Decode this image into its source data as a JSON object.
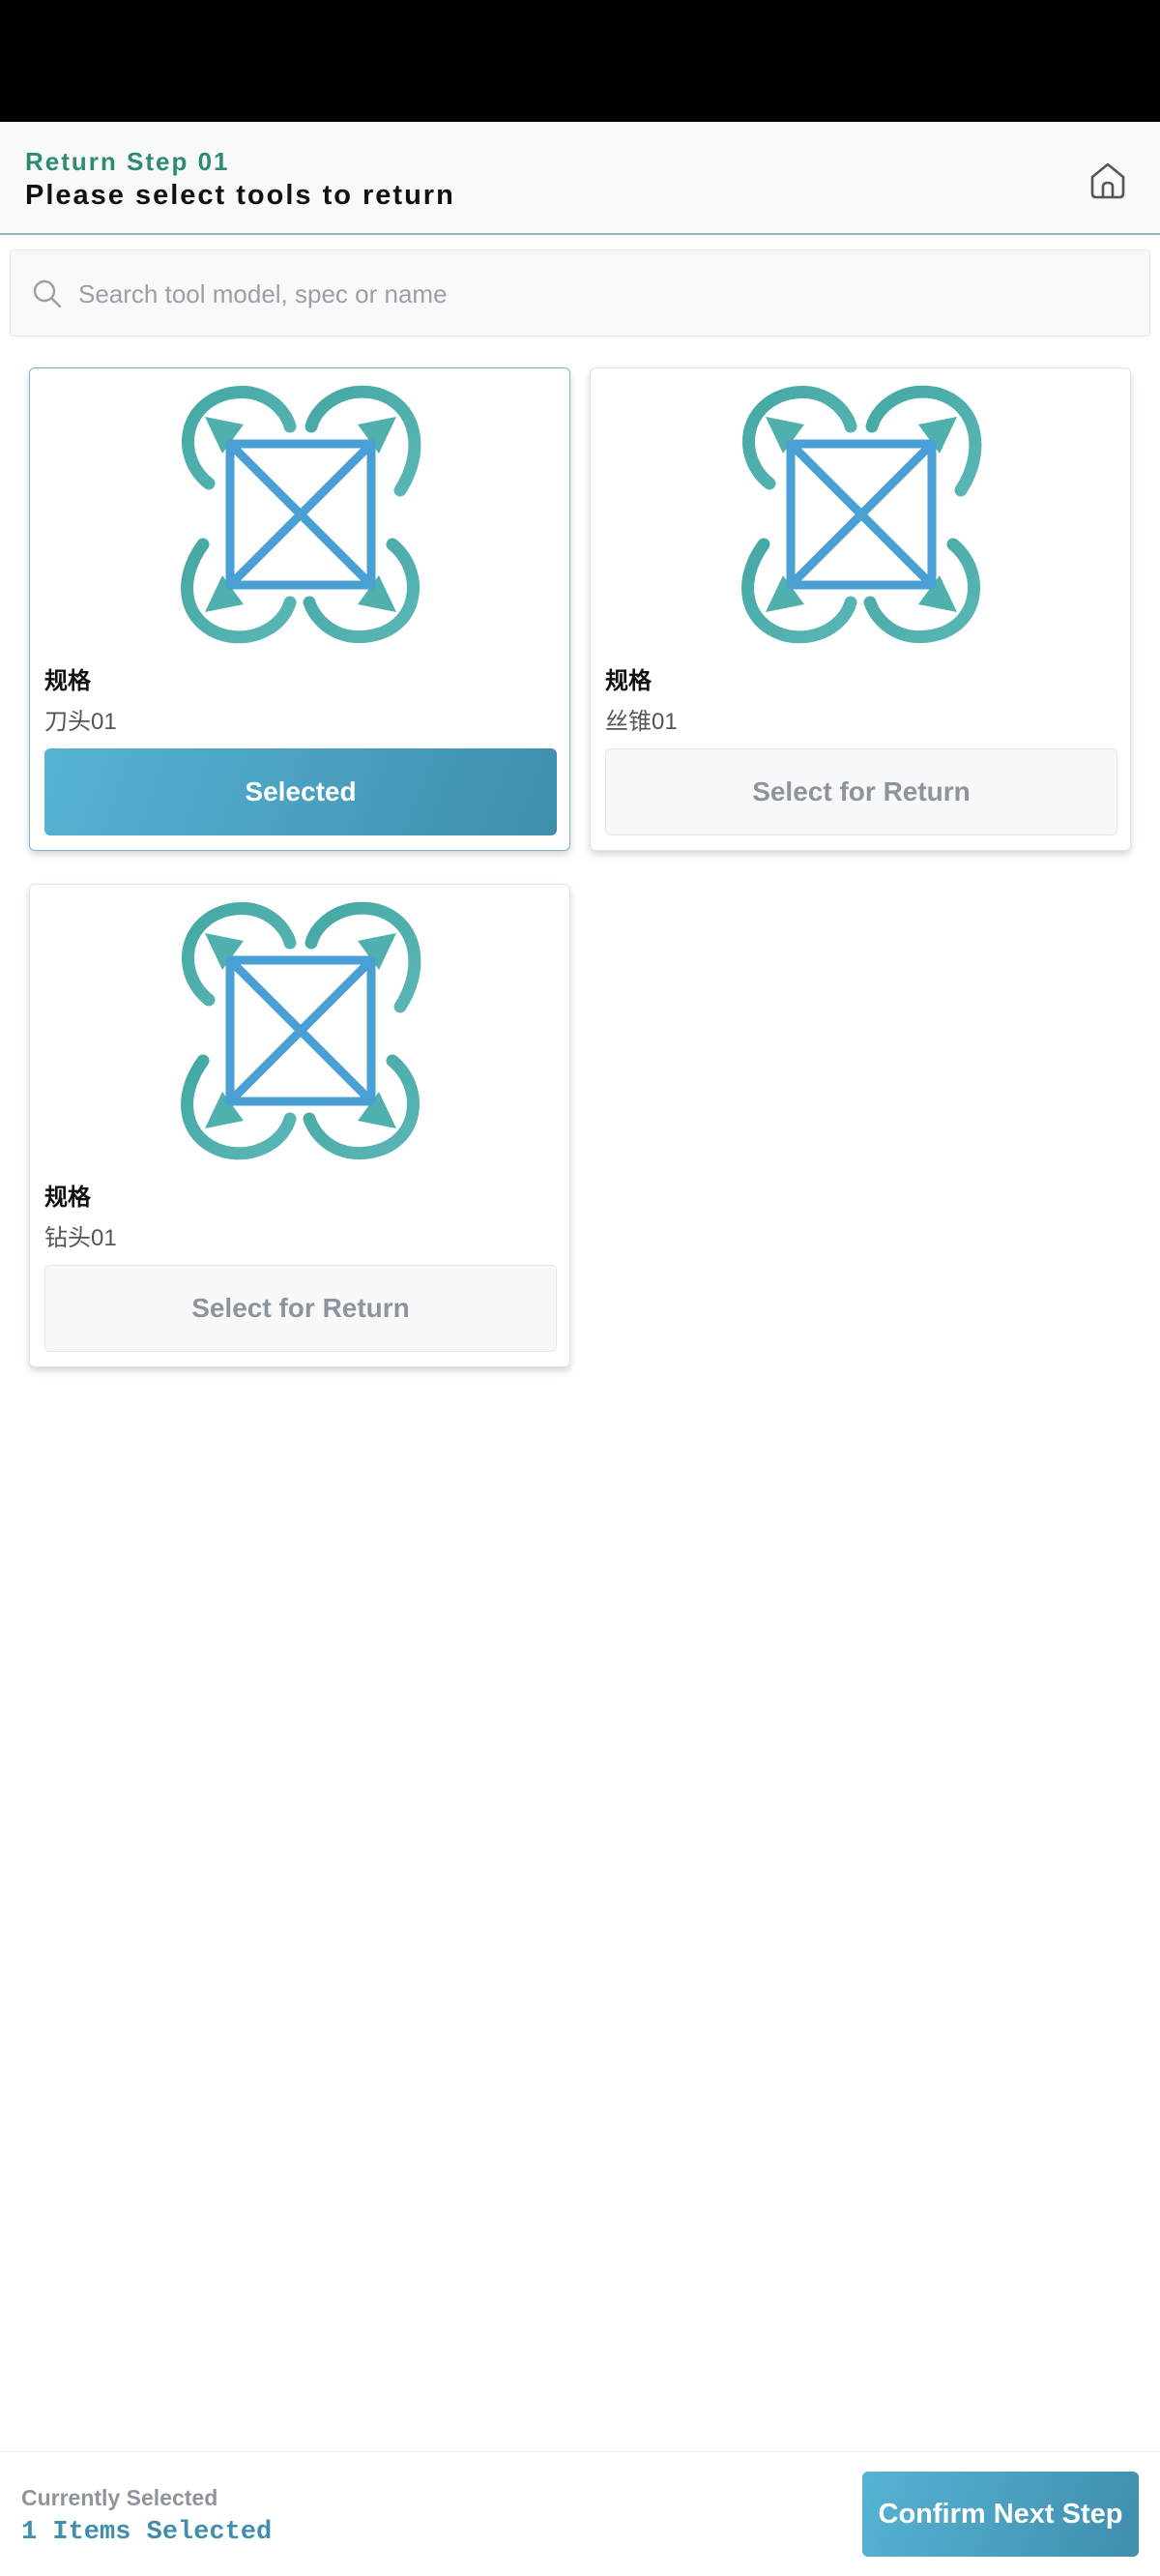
{
  "header": {
    "step": "Return Step 01",
    "title": "Please select tools to return",
    "home_icon": "home-icon"
  },
  "search": {
    "placeholder": "Search tool model, spec or name",
    "value": "",
    "icon": "search-icon"
  },
  "tools": [
    {
      "spec_label": "规格",
      "spec_value": "刀头01",
      "button_label": "Selected",
      "selected": true,
      "image_icon": "tool-placeholder-icon"
    },
    {
      "spec_label": "规格",
      "spec_value": "丝锥01",
      "button_label": "Select for Return",
      "selected": false,
      "image_icon": "tool-placeholder-icon"
    },
    {
      "spec_label": "规格",
      "spec_value": "钻头01",
      "button_label": "Select for Return",
      "selected": false,
      "image_icon": "tool-placeholder-icon"
    }
  ],
  "footer": {
    "current_label": "Currently Selected",
    "count_text": "1 Items Selected",
    "confirm_label": "Confirm Next Step"
  },
  "colors": {
    "accent": "#3f8eac",
    "accent_light": "#56b3d4",
    "step_green": "#2e8b6e",
    "icon_teal": "#4fb0ae",
    "icon_blue": "#4a9fd4"
  }
}
